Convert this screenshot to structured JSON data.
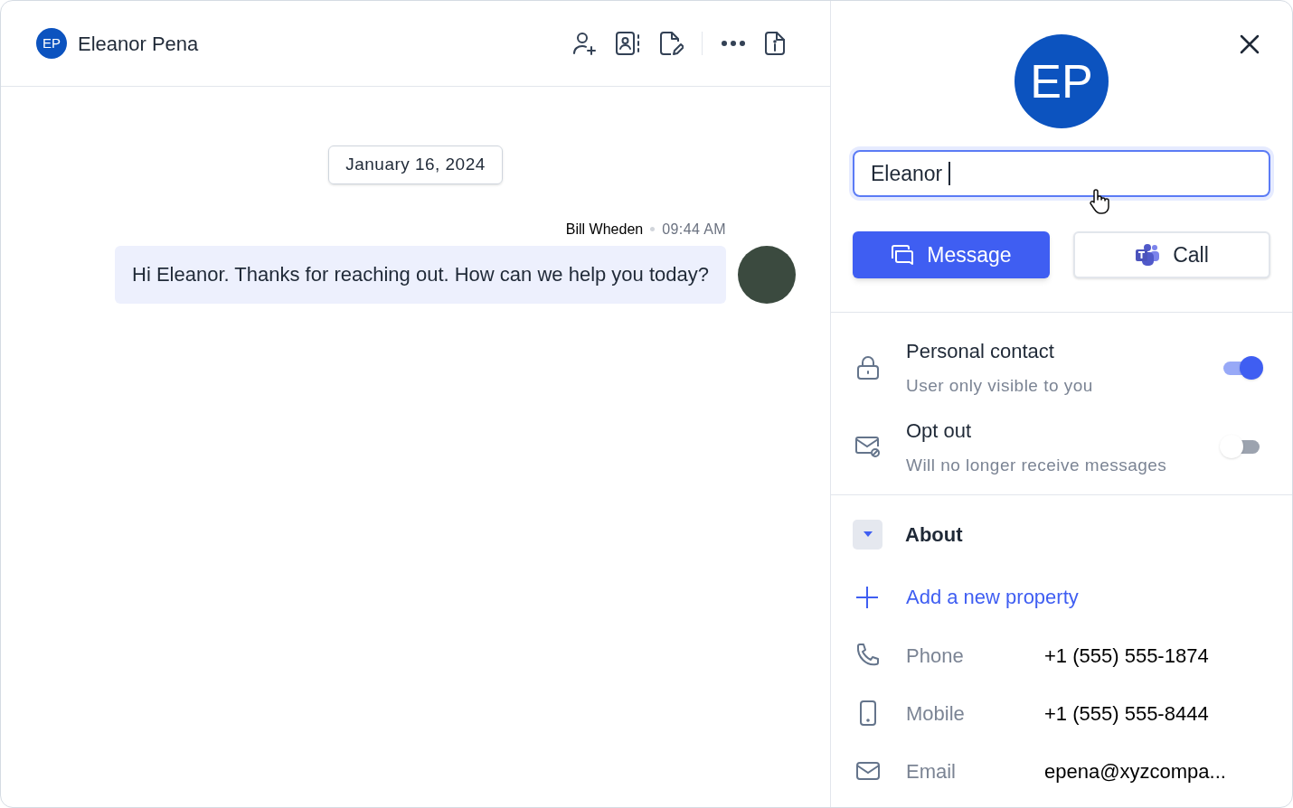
{
  "header": {
    "initials": "EP",
    "name": "Eleanor Pena"
  },
  "date": "January 16, 2024",
  "messages": [
    {
      "sender": "Bill Wheden",
      "time": "09:44 AM",
      "text": "Hi Eleanor. Thanks for reaching out. How can we help you today?"
    }
  ],
  "contact": {
    "initials": "EP",
    "name_value": "Eleanor ",
    "buttons": [
      {
        "label": "Message",
        "kind": "primary"
      },
      {
        "label": "Call",
        "kind": "secondary"
      }
    ]
  },
  "settings": [
    {
      "kind": "lock",
      "title": "Personal contact",
      "subtitle": "User only visible to you",
      "on": true
    },
    {
      "kind": "mail-off",
      "title": "Opt out",
      "subtitle": "Will no longer receive messages",
      "on": false
    }
  ],
  "about": {
    "title": "About",
    "expanded": true,
    "add_label": "Add a new property",
    "properties": [
      {
        "kind": "phone",
        "label": "Phone",
        "value": "+1 (555) 555-1874"
      },
      {
        "kind": "mobile",
        "label": "Mobile",
        "value": "+1 (555) 555-8444"
      },
      {
        "kind": "email",
        "label": "Email",
        "value": "epena@xyzcompa..."
      }
    ]
  }
}
